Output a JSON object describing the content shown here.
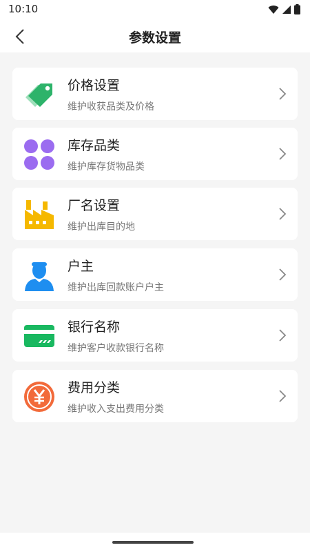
{
  "status": {
    "time": "10:10"
  },
  "header": {
    "title": "参数设置"
  },
  "items": [
    {
      "title": "价格设置",
      "subtitle": "维护收获品类及价格",
      "icon": "price-tag-icon"
    },
    {
      "title": "库存品类",
      "subtitle": "维护库存货物品类",
      "icon": "category-grid-icon"
    },
    {
      "title": "厂名设置",
      "subtitle": "维护出库目的地",
      "icon": "factory-icon"
    },
    {
      "title": "户主",
      "subtitle": "维护出库回款账户户主",
      "icon": "user-icon"
    },
    {
      "title": "银行名称",
      "subtitle": "维护客户收款银行名称",
      "icon": "bank-card-icon"
    },
    {
      "title": "费用分类",
      "subtitle": "维护收入支出费用分类",
      "icon": "yuan-coin-icon"
    }
  ],
  "colors": {
    "background": "#f5f5f5",
    "tag_green": "#2db36a",
    "grid_purple": "#9b6cf0",
    "factory_yellow": "#f5b800",
    "user_blue": "#1e8ef0",
    "card_green": "#19b860",
    "coin_orange": "#f26a3a"
  }
}
